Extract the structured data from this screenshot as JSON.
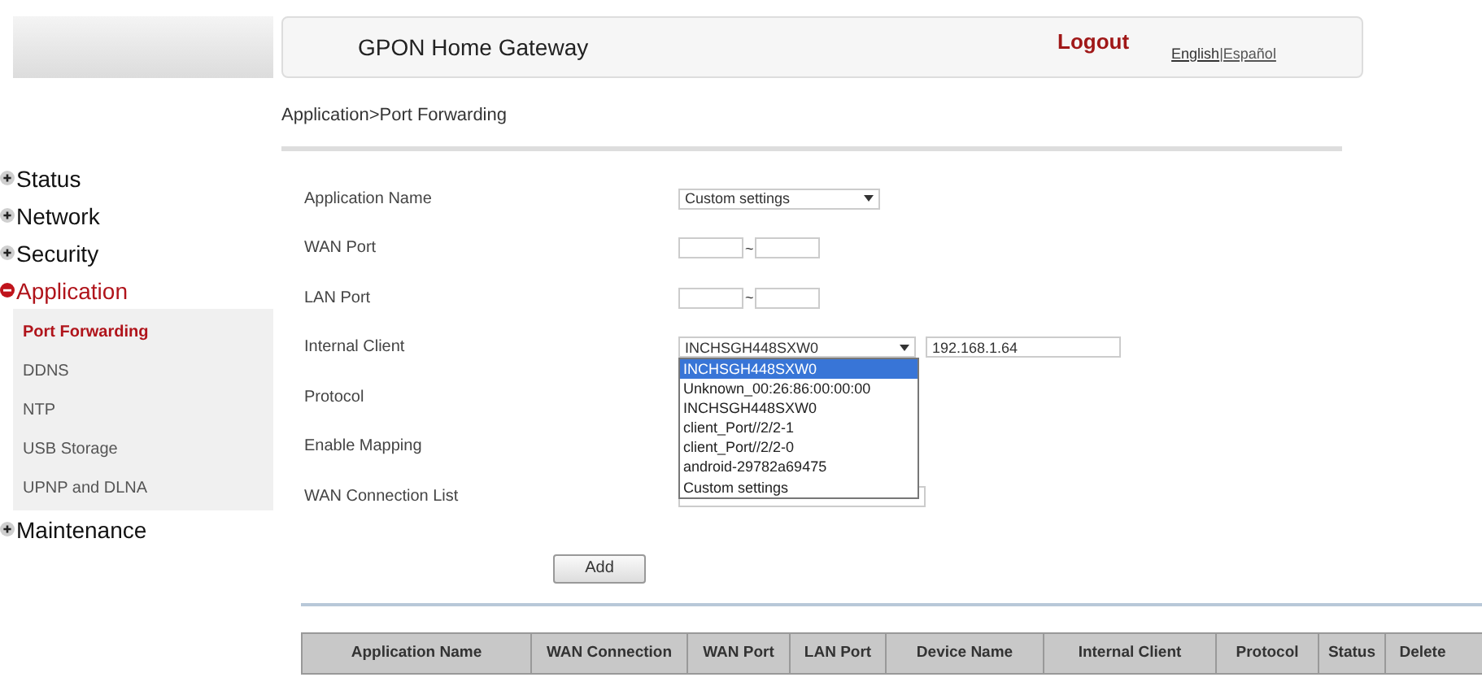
{
  "header": {
    "title": "GPON Home Gateway",
    "logout": "Logout",
    "languages": [
      {
        "label": "English",
        "selected": true
      },
      {
        "label": "|Español",
        "selected": false
      }
    ]
  },
  "sidebar": {
    "items": [
      {
        "label": "Status",
        "expanded": false
      },
      {
        "label": "Network",
        "expanded": false
      },
      {
        "label": "Security",
        "expanded": false
      },
      {
        "label": "Application",
        "expanded": true,
        "children": [
          {
            "label": "Port Forwarding",
            "selected": true
          },
          {
            "label": "DDNS",
            "selected": false
          },
          {
            "label": "NTP",
            "selected": false
          },
          {
            "label": "USB Storage",
            "selected": false
          },
          {
            "label": "UPNP and DLNA",
            "selected": false
          }
        ]
      },
      {
        "label": "Maintenance",
        "expanded": false
      }
    ]
  },
  "breadcrumb": "Application>Port Forwarding",
  "form": {
    "fields": [
      {
        "label": "Application Name",
        "kind": "select",
        "value": "Custom settings"
      },
      {
        "label": "WAN Port",
        "kind": "range",
        "separator": "~"
      },
      {
        "label": "LAN Port",
        "kind": "range",
        "separator": "~"
      },
      {
        "label": "Internal Client",
        "kind": "client",
        "value": "INCHSGH448SXW0",
        "ip": "192.168.1.64"
      },
      {
        "label": "Protocol",
        "kind": "blank"
      },
      {
        "label": "Enable Mapping",
        "kind": "blank"
      },
      {
        "label": "WAN Connection List",
        "kind": "select"
      }
    ],
    "dropdown": {
      "options": [
        {
          "label": "INCHSGH448SXW0",
          "selected": true
        },
        {
          "label": "Unknown_00:26:86:00:00:00",
          "selected": false
        },
        {
          "label": "INCHSGH448SXW0",
          "selected": false
        },
        {
          "label": "client_Port//2/2-1",
          "selected": false
        },
        {
          "label": "client_Port//2/2-0",
          "selected": false
        },
        {
          "label": "android-29782a69475",
          "selected": false
        },
        {
          "label": "Custom settings",
          "selected": false
        }
      ]
    },
    "add_button": "Add"
  },
  "table": {
    "columns": [
      "Application Name",
      "WAN Connection",
      "WAN Port",
      "LAN Port",
      "Device Name",
      "Internal Client",
      "Protocol",
      "Status",
      "Delete"
    ]
  }
}
